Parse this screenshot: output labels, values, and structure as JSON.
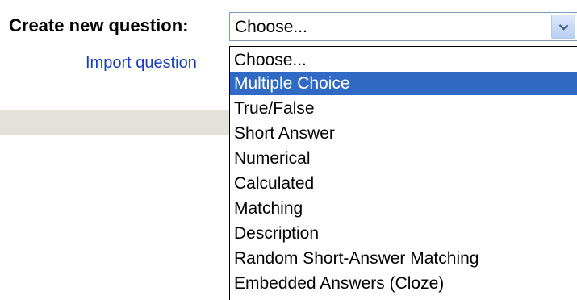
{
  "form": {
    "create_label": "Create new question:",
    "import_link": "Import question"
  },
  "select": {
    "current_value": "Choose...",
    "arrow_icon": "chevron-down-icon",
    "highlight_color": "#316ac5",
    "options": [
      "Choose...",
      "Multiple Choice",
      "True/False",
      "Short Answer",
      "Numerical",
      "Calculated",
      "Matching",
      "Description",
      "Random Short-Answer Matching",
      "Embedded Answers (Cloze)"
    ],
    "highlighted_option": "Multiple Choice"
  },
  "colors": {
    "link": "#1a3bbd",
    "band": "#e4e1da"
  }
}
